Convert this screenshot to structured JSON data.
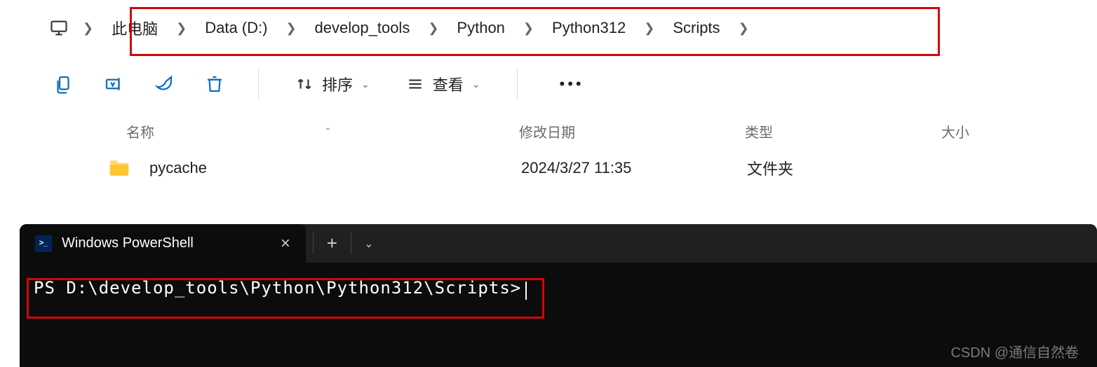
{
  "breadcrumb": {
    "items": [
      "此电脑",
      "Data (D:)",
      "develop_tools",
      "Python",
      "Python312",
      "Scripts"
    ]
  },
  "toolbar": {
    "sort_label": "排序",
    "view_label": "查看"
  },
  "columns": {
    "name": "名称",
    "date": "修改日期",
    "type": "类型",
    "size": "大小"
  },
  "files": [
    {
      "name": "pycache",
      "date": "2024/3/27 11:35",
      "type": "文件夹",
      "size": ""
    }
  ],
  "terminal": {
    "tab_title": "Windows PowerShell",
    "prompt": "PS D:\\develop_tools\\Python\\Python312\\Scripts>"
  },
  "watermark": "CSDN @通信自然卷"
}
